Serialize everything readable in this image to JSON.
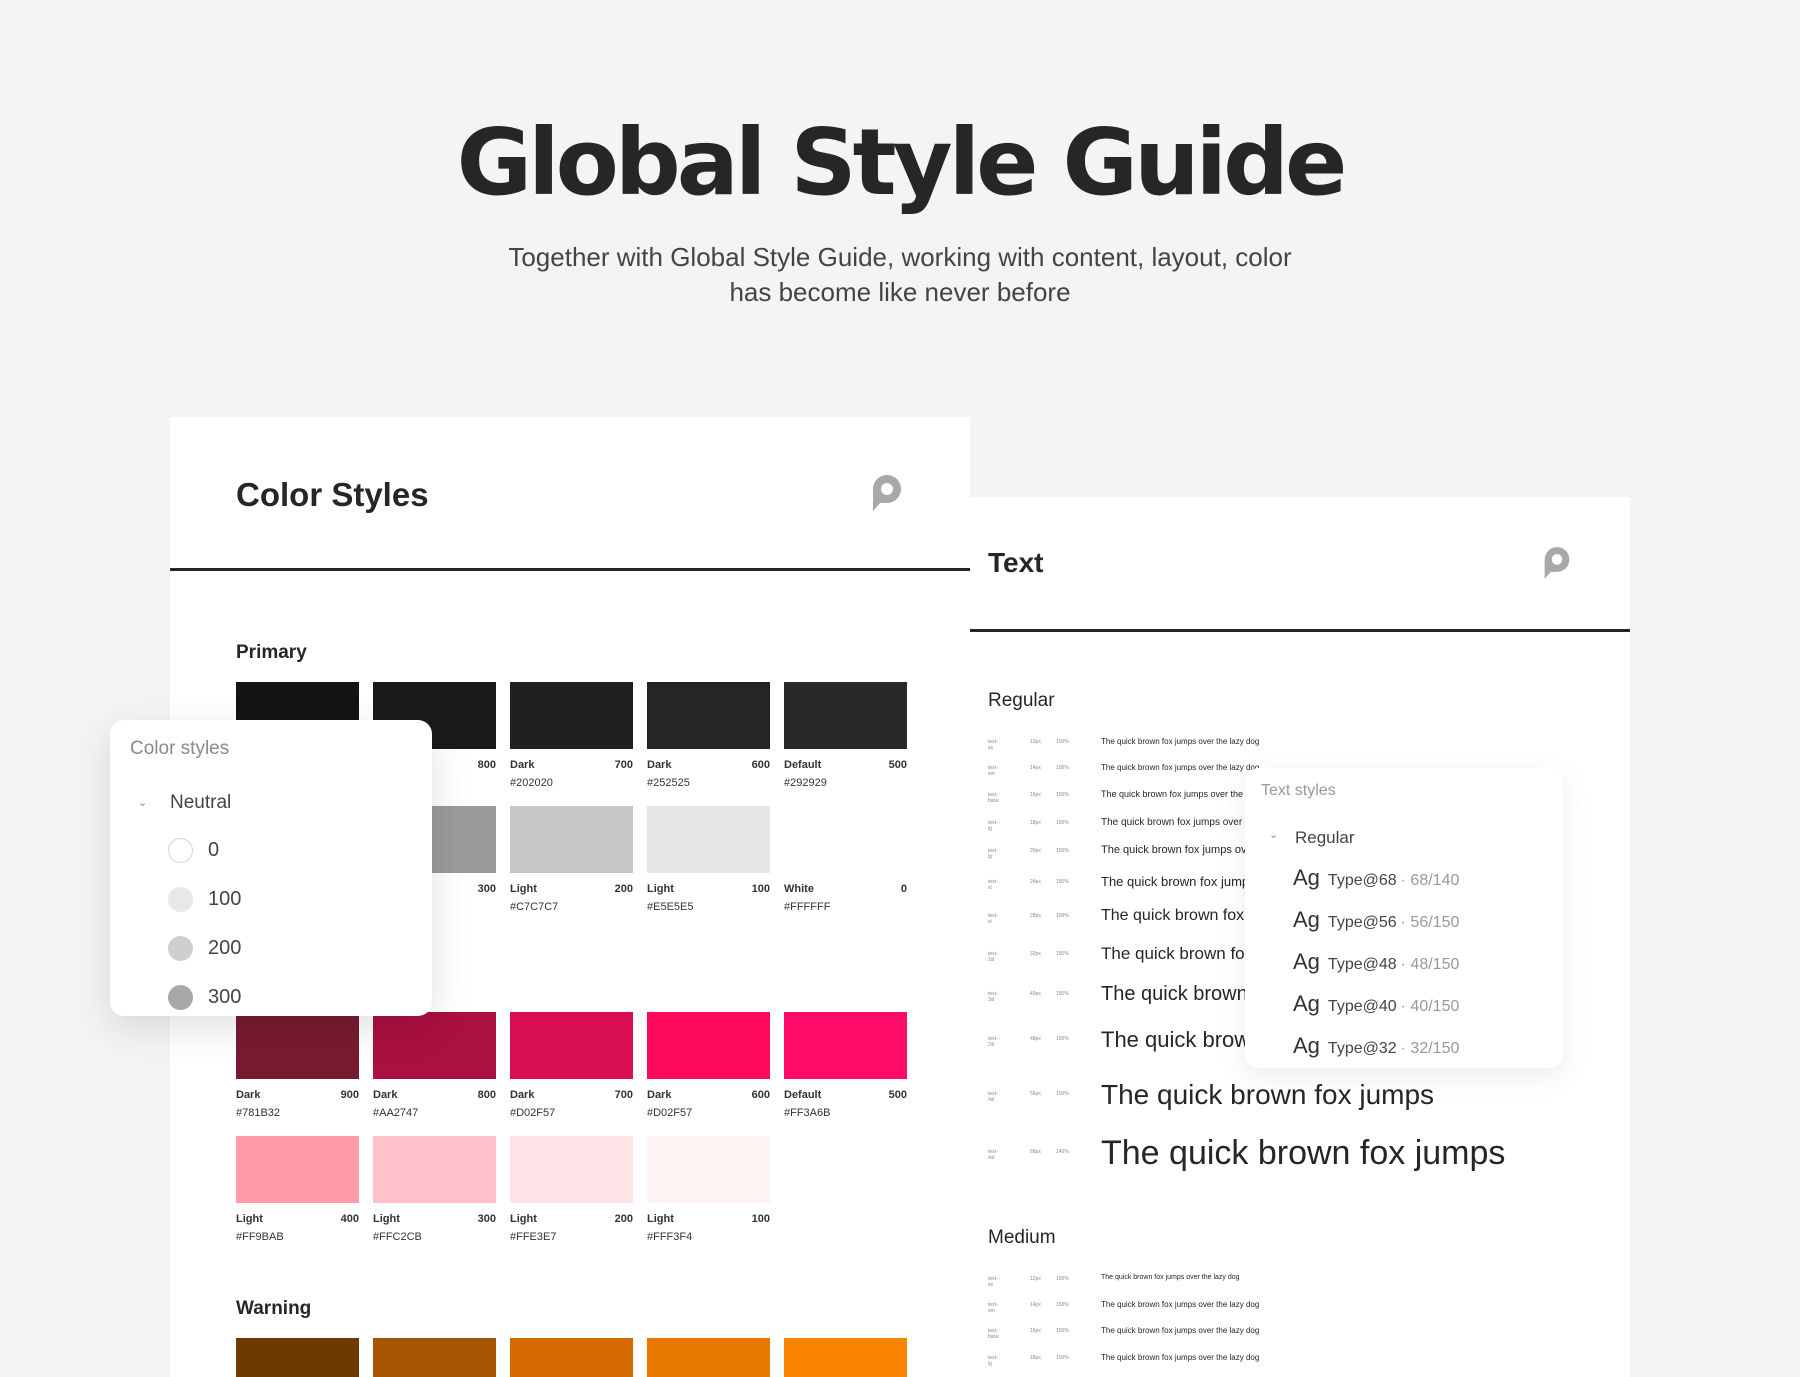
{
  "hero": {
    "title": "Global Style Guide",
    "subtitle_line1": "Together with Global Style Guide, working with content, layout, color",
    "subtitle_line2": "has become like never before"
  },
  "color_card": {
    "title": "Color Styles",
    "logo": "p-logo-icon",
    "sections": {
      "primary": "Primary",
      "warning": "Warning"
    },
    "primary_row1": [
      {
        "shade": "",
        "num": "",
        "hex": "",
        "color": "#141414"
      },
      {
        "shade": "",
        "num": "800",
        "hex": "",
        "color": "#1a1a1a"
      },
      {
        "shade": "Dark",
        "num": "700",
        "hex": "#202020",
        "color": "#202020"
      },
      {
        "shade": "Dark",
        "num": "600",
        "hex": "#252525",
        "color": "#252525"
      },
      {
        "shade": "Default",
        "num": "500",
        "hex": "#292929",
        "color": "#292929"
      }
    ],
    "primary_row2": [
      {
        "shade": "",
        "num": "",
        "hex": "",
        "color": "#7a7a7a"
      },
      {
        "shade": "",
        "num": "300",
        "hex": "",
        "color": "#9b9b9b"
      },
      {
        "shade": "Light",
        "num": "200",
        "hex": "#C7C7C7",
        "color": "#C7C7C7"
      },
      {
        "shade": "Light",
        "num": "100",
        "hex": "#E5E5E5",
        "color": "#E5E5E5"
      },
      {
        "shade": "White",
        "num": "0",
        "hex": "#FFFFFF",
        "color": "#FFFFFF"
      }
    ],
    "pink_row1": [
      {
        "shade": "Dark",
        "num": "900",
        "hex": "#781B32",
        "color": "#781B32"
      },
      {
        "shade": "Dark",
        "num": "800",
        "hex": "#AA2747",
        "color": "#AA1040"
      },
      {
        "shade": "Dark",
        "num": "700",
        "hex": "#D02F57",
        "color": "#D80E50"
      },
      {
        "shade": "Dark",
        "num": "600",
        "hex": "#D02F57",
        "color": "#FF0A5C"
      },
      {
        "shade": "Default",
        "num": "500",
        "hex": "#FF3A6B",
        "color": "#FF0A66"
      }
    ],
    "pink_row2": [
      {
        "shade": "Light",
        "num": "400",
        "hex": "#FF9BAB",
        "color": "#FF9BAB"
      },
      {
        "shade": "Light",
        "num": "300",
        "hex": "#FFC2CB",
        "color": "#FFC2CB"
      },
      {
        "shade": "Light",
        "num": "200",
        "hex": "#FFE3E7",
        "color": "#FFE3E7"
      },
      {
        "shade": "Light",
        "num": "100",
        "hex": "#FFF3F4",
        "color": "#FFF3F4"
      }
    ],
    "warning_row": [
      {
        "color": "#6E3A00"
      },
      {
        "color": "#A65500"
      },
      {
        "color": "#D56A00"
      },
      {
        "color": "#E87700"
      },
      {
        "color": "#F88400"
      }
    ]
  },
  "color_panel": {
    "title": "Color styles",
    "group": "Neutral",
    "items": [
      {
        "value": "0",
        "color": "#FFFFFF"
      },
      {
        "value": "100",
        "color": "#E8E8E8"
      },
      {
        "value": "200",
        "color": "#CFCFCF"
      },
      {
        "value": "300",
        "color": "#A8A8A8"
      }
    ]
  },
  "text_card": {
    "title": "Text",
    "logo": "p-logo-icon",
    "regular_label": "Regular",
    "medium_label": "Medium",
    "regular_rows": [
      {
        "tok": "text-xs",
        "sz": "12px",
        "lh": "150%",
        "sample": "The quick brown fox jumps over the lazy dog",
        "font": 8
      },
      {
        "tok": "text-sm",
        "sz": "14px",
        "lh": "150%",
        "sample": "The quick brown fox jumps over the lazy dog",
        "font": 8
      },
      {
        "tok": "text-base",
        "sz": "16px",
        "lh": "150%",
        "sample": "The quick brown fox jumps over the lazy",
        "font": 9
      },
      {
        "tok": "text-lg",
        "sz": "18px",
        "lh": "150%",
        "sample": "The quick brown fox jumps over the",
        "font": 10
      },
      {
        "tok": "text-lg",
        "sz": "20px",
        "lh": "150%",
        "sample": "The quick brown fox jumps over",
        "font": 11
      },
      {
        "tok": "text-xl",
        "sz": "24px",
        "lh": "150%",
        "sample": "The quick brown fox jumps",
        "font": 13
      },
      {
        "tok": "text-xl",
        "sz": "28px",
        "lh": "150%",
        "sample": "The quick brown fox",
        "font": 16
      },
      {
        "tok": "text-2xl",
        "sz": "32px",
        "lh": "150%",
        "sample": "The quick brown fox",
        "font": 17
      },
      {
        "tok": "text-3xl",
        "sz": "40px",
        "lh": "150%",
        "sample": "The quick brown",
        "font": 20
      },
      {
        "tok": "text-2xl",
        "sz": "48px",
        "lh": "150%",
        "sample": "The quick brow",
        "font": 22
      },
      {
        "tok": "text-4xl",
        "sz": "56px",
        "lh": "150%",
        "sample": "The quick brown fox jumps",
        "font": 28
      },
      {
        "tok": "text-4xl",
        "sz": "68px",
        "lh": "140%",
        "sample": "The quick brown fox jumps",
        "font": 34
      }
    ],
    "medium_rows": [
      {
        "tok": "text-xs",
        "sz": "12px",
        "lh": "150%",
        "sample": "The quick brown fox jumps over the lazy dog",
        "font": 7
      },
      {
        "tok": "text-sm",
        "sz": "14px",
        "lh": "150%",
        "sample": "The quick brown fox jumps over the lazy dog",
        "font": 8
      },
      {
        "tok": "text-base",
        "sz": "16px",
        "lh": "150%",
        "sample": "The quick brown fox jumps over the lazy dog",
        "font": 8
      },
      {
        "tok": "text-lg",
        "sz": "18px",
        "lh": "150%",
        "sample": "The quick brown fox jumps over the lazy dog",
        "font": 8
      }
    ]
  },
  "text_panel": {
    "title": "Text styles",
    "group": "Regular",
    "items": [
      {
        "ag": "Ag",
        "name": "Type@68",
        "spec": "· 68/140"
      },
      {
        "ag": "Ag",
        "name": "Type@56",
        "spec": "· 56/150"
      },
      {
        "ag": "Ag",
        "name": "Type@48",
        "spec": "· 48/150"
      },
      {
        "ag": "Ag",
        "name": "Type@40",
        "spec": "· 40/150"
      },
      {
        "ag": "Ag",
        "name": "Type@32",
        "spec": "· 32/150"
      }
    ]
  }
}
